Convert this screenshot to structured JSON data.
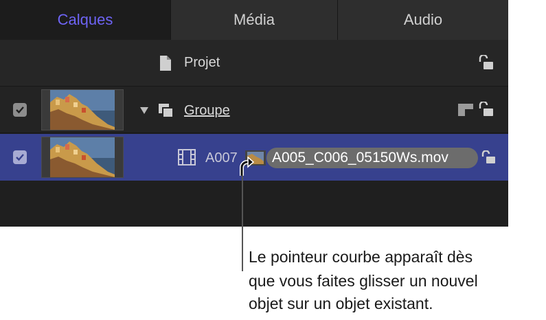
{
  "tabs": [
    {
      "label": "Calques",
      "active": true
    },
    {
      "label": "Média",
      "active": false
    },
    {
      "label": "Audio",
      "active": false
    }
  ],
  "layers": {
    "project": {
      "label": "Projet",
      "icon": "document-icon",
      "lock_icon": "unlock-icon"
    },
    "group": {
      "label": "Groupe",
      "checked": true,
      "icon": "group-layers-icon",
      "disclosure": "triangle-down-icon",
      "extra_icon": "group-badge-icon",
      "lock_icon": "unlock-icon"
    },
    "clip": {
      "label": "A007",
      "checked": true,
      "icon": "film-strip-icon",
      "lock_icon": "unlock-icon"
    }
  },
  "drag": {
    "tooltip": "A005_C006_05150Ws.mov",
    "cursor_icon": "curved-pointer-icon"
  },
  "caption": {
    "lines": [
      "Le pointeur courbe apparaît dès",
      "que vous faites glisser un nouvel",
      "objet sur un objet existant."
    ]
  },
  "colors": {
    "active_tab": "#6e64f5",
    "selected_row": "#37418e",
    "panel_bg": "#1f1f1f"
  }
}
